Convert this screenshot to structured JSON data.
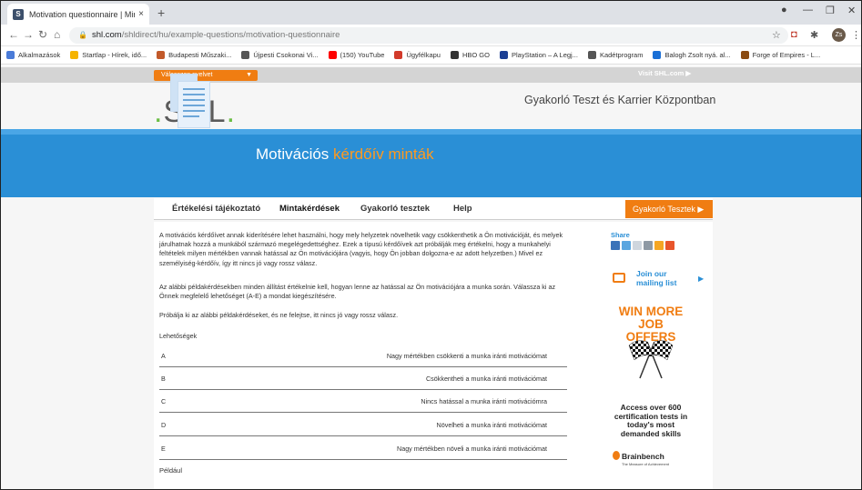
{
  "browser": {
    "tab_title": "Motivation questionnaire | Mintá",
    "tab_close": "×",
    "new_tab": "+",
    "url_host": "shl.com",
    "url_path": "/shldirect/hu/example-questions/motivation-questionnaire",
    "avatar_initials": "Zs",
    "bookmarks": [
      {
        "label": "Alkalmazások",
        "color": "#4a7bd8"
      },
      {
        "label": "Startlap - Hírek, idő...",
        "color": "#f6b400"
      },
      {
        "label": "Budapesti Műszaki...",
        "color": "#c25a2a"
      },
      {
        "label": "Újpesti Csokonai Vi...",
        "color": "#555555"
      },
      {
        "label": "(150) YouTube",
        "color": "#ff0000"
      },
      {
        "label": "Ügyfélkapu",
        "color": "#d23a2a"
      },
      {
        "label": "HBO GO",
        "color": "#333333"
      },
      {
        "label": "PlayStation – A Legj...",
        "color": "#1c3f94"
      },
      {
        "label": "Kadétprogram",
        "color": "#555555"
      },
      {
        "label": "Balogh Zsolt nyá. al...",
        "color": "#1a6fd6"
      },
      {
        "label": "Forge of Empires - L...",
        "color": "#8a4b12"
      }
    ]
  },
  "site": {
    "lang_select": "Válasszon nyelvet",
    "visit": "Visit SHL.com ▶",
    "logo_text": "SHL",
    "headline": "Gyakorló Teszt és Karrier Központban",
    "hero_title_1": "Motivációs",
    "hero_title_2": "kérdőív minták",
    "nav_tabs": [
      "Értékelési tájékoztató",
      "Mintakérdések",
      "Gyakorló tesztek",
      "Help"
    ],
    "cta": "Gyakorló Tesztek ▶"
  },
  "content": {
    "para1": "A motivációs kérdőívet annak kiderítésére lehet használni, hogy mely helyzetek növelhetik vagy csökkenthetik a Ön motivációját, és melyek járulhatnak hozzá a munkából származó megelégedettséghez. Ezek a típusú kérdőívek azt próbálják meg értékelni, hogy a munkahelyi feltételek milyen mértékben vannak hatással az Ön motivációjára (vagyis, hogy Ön jobban dolgozna-e az adott helyzetben.) Mivel ez személyiség-kérdőív, így itt nincs jó vagy rossz válasz.",
    "para2": "Az alábbi példakérdésekben minden állítást értékelnie kell, hogyan lenne az hatással az Ön motivációjára a munka során. Válassza ki az Önnek megfelelő lehetőséget (A-E) a mondat kiegészítésére.",
    "para3": "Próbálja ki az alábbi példakérdéseket, és ne felejtse, itt nincs jó vagy rossz válasz.",
    "options_label": "Lehetőségek",
    "options": [
      {
        "key": "A",
        "text": "Nagy mértékben csökkenti a munka iránti motivációmat"
      },
      {
        "key": "B",
        "text": "Csökkentheti a munka iránti motivációmat"
      },
      {
        "key": "C",
        "text": "Nincs hatással a munka iránti motivációmra"
      },
      {
        "key": "D",
        "text": "Növelheti a munka iránti motivációmat"
      },
      {
        "key": "E",
        "text": "Nagy mértékben növeli a munka iránti motivációmat"
      }
    ],
    "example": "Például"
  },
  "sidebar": {
    "share": "Share",
    "mailing": "Join our mailing list",
    "ad_title": "WIN MORE JOB OFFERS",
    "ad_body": "Access over 600 certification tests in today's most demanded skills",
    "ad_brand": "Brainbench",
    "ad_brand_sub": "The Measure of Achievement"
  }
}
